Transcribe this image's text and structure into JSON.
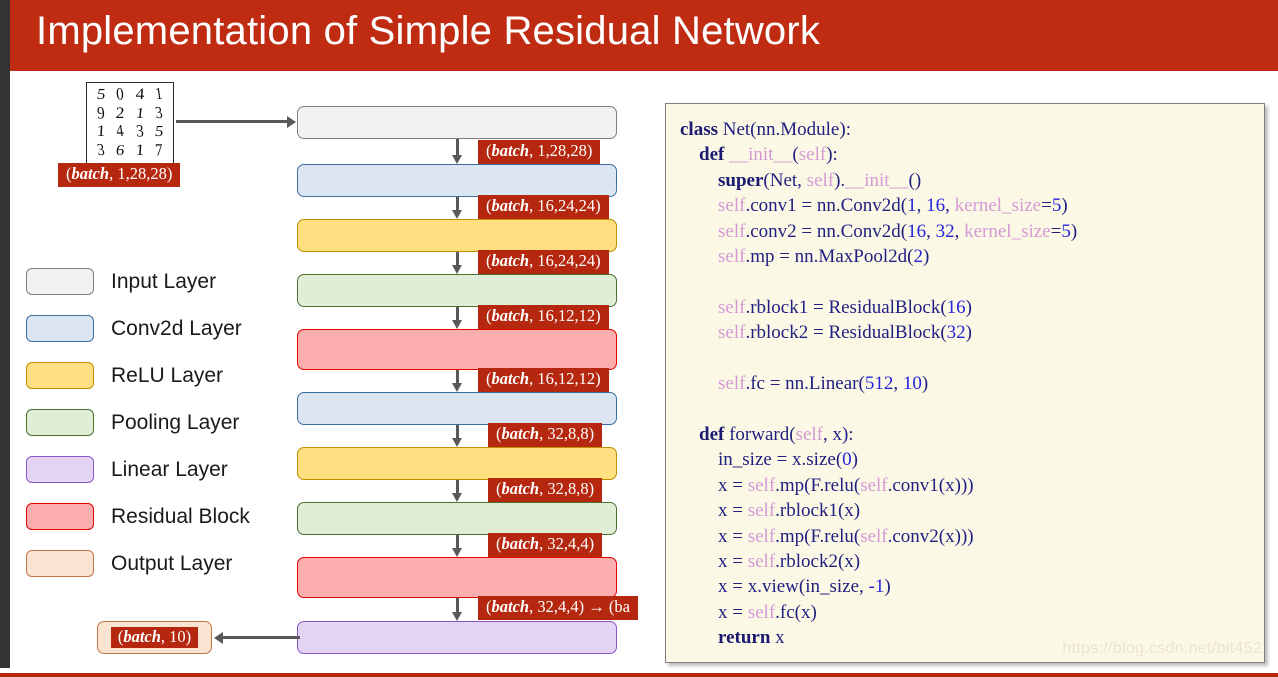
{
  "slide": {
    "title": "Implementation of Simple Residual Network",
    "title_bar_color": "#bf2c12",
    "accent_color": "#b5280f",
    "background": "#ffffff"
  },
  "input_image": {
    "alt": "mnist-digit-grid",
    "rows": [
      [
        "5",
        "0",
        "4",
        "1"
      ],
      [
        "9",
        "2",
        "1",
        "3"
      ],
      [
        "1",
        "4",
        "3",
        "5"
      ],
      [
        "3",
        "6",
        "1",
        "7"
      ]
    ]
  },
  "legend": {
    "items": [
      {
        "label": "Input Layer",
        "fill": "#f2f2f2",
        "stroke": "#7f7f7f"
      },
      {
        "label": "Conv2d Layer",
        "fill": "#dce6f2",
        "stroke": "#3a6e9e"
      },
      {
        "label": "ReLU Layer",
        "fill": "#ffdf80",
        "stroke": "#bf8f00"
      },
      {
        "label": "Pooling Layer",
        "fill": "#e1eed7",
        "stroke": "#4d7031"
      },
      {
        "label": "Linear Layer",
        "fill": "#e4d4f4",
        "stroke": "#8a57c6"
      },
      {
        "label": "Residual Block",
        "fill": "#fcaeae",
        "stroke": "#e00000"
      },
      {
        "label": "Output Layer",
        "fill": "#fbe3d2",
        "stroke": "#c0744a"
      }
    ]
  },
  "diagram": {
    "blocks": [
      {
        "type": "input",
        "legend": "Input Layer"
      },
      {
        "type": "conv",
        "legend": "Conv2d Layer"
      },
      {
        "type": "relu",
        "legend": "ReLU Layer"
      },
      {
        "type": "pool",
        "legend": "Pooling Layer"
      },
      {
        "type": "residual",
        "legend": "Residual Block"
      },
      {
        "type": "conv",
        "legend": "Conv2d Layer"
      },
      {
        "type": "relu",
        "legend": "ReLU Layer"
      },
      {
        "type": "pool",
        "legend": "Pooling Layer"
      },
      {
        "type": "residual",
        "legend": "Residual Block"
      },
      {
        "type": "linear",
        "legend": "Linear Layer"
      }
    ],
    "shape_tags": {
      "input_source": "(batch, 1,28,28)",
      "after_input": "(batch, 1,28,28)",
      "after_conv1": "(batch, 16,24,24)",
      "after_relu1": "(batch, 16,24,24)",
      "after_pool1": "(batch, 16,12,12)",
      "after_rblock1": "(batch, 16,12,12)",
      "after_conv2": "(batch, 32,8,8)",
      "after_relu2": "(batch, 32,8,8)",
      "after_pool2": "(batch, 32,4,4)",
      "after_rblock2": "(batch, 32,4,4) → (ba",
      "output": "(batch, 10)"
    }
  },
  "code": {
    "language": "python",
    "watermark": "https://blog.csdn.net/bit452",
    "text": "class Net(nn.Module):\n    def __init__(self):\n        super(Net, self).__init__()\n        self.conv1 = nn.Conv2d(1, 16, kernel_size=5)\n        self.conv2 = nn.Conv2d(16, 32, kernel_size=5)\n        self.mp = nn.MaxPool2d(2)\n\n        self.rblock1 = ResidualBlock(16)\n        self.rblock2 = ResidualBlock(32)\n\n        self.fc = nn.Linear(512, 10)\n\n    def forward(self, x):\n        in_size = x.size(0)\n        x = self.mp(F.relu(self.conv1(x)))\n        x = self.rblock1(x)\n        x = self.mp(F.relu(self.conv2(x)))\n        x = self.rblock2(x)\n        x = x.view(in_size, -1)\n        x = self.fc(x)\n        return x"
  }
}
